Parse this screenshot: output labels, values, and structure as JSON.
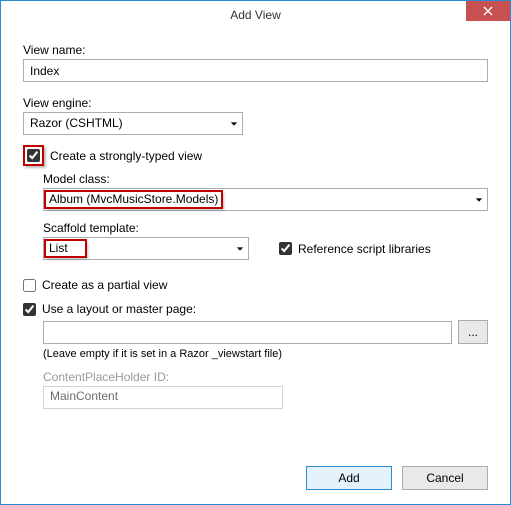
{
  "window": {
    "title": "Add View"
  },
  "labels": {
    "view_name": "View name:",
    "view_engine": "View engine:",
    "create_strong": "Create a strongly-typed view",
    "model_class": "Model class:",
    "scaffold_template": "Scaffold template:",
    "ref_scripts": "Reference script libraries",
    "partial": "Create as a partial view",
    "use_layout": "Use a layout or master page:",
    "layout_hint": "(Leave empty if it is set in a Razor _viewstart file)",
    "cph_id": "ContentPlaceHolder ID:",
    "browse": "..."
  },
  "values": {
    "view_name": "Index",
    "view_engine": "Razor (CSHTML)",
    "model_class": "Album (MvcMusicStore.Models)",
    "scaffold_template": "List",
    "layout_path": "",
    "cph_id": "MainContent"
  },
  "checks": {
    "create_strong": true,
    "ref_scripts": true,
    "partial": false,
    "use_layout": true
  },
  "buttons": {
    "add": "Add",
    "cancel": "Cancel"
  }
}
